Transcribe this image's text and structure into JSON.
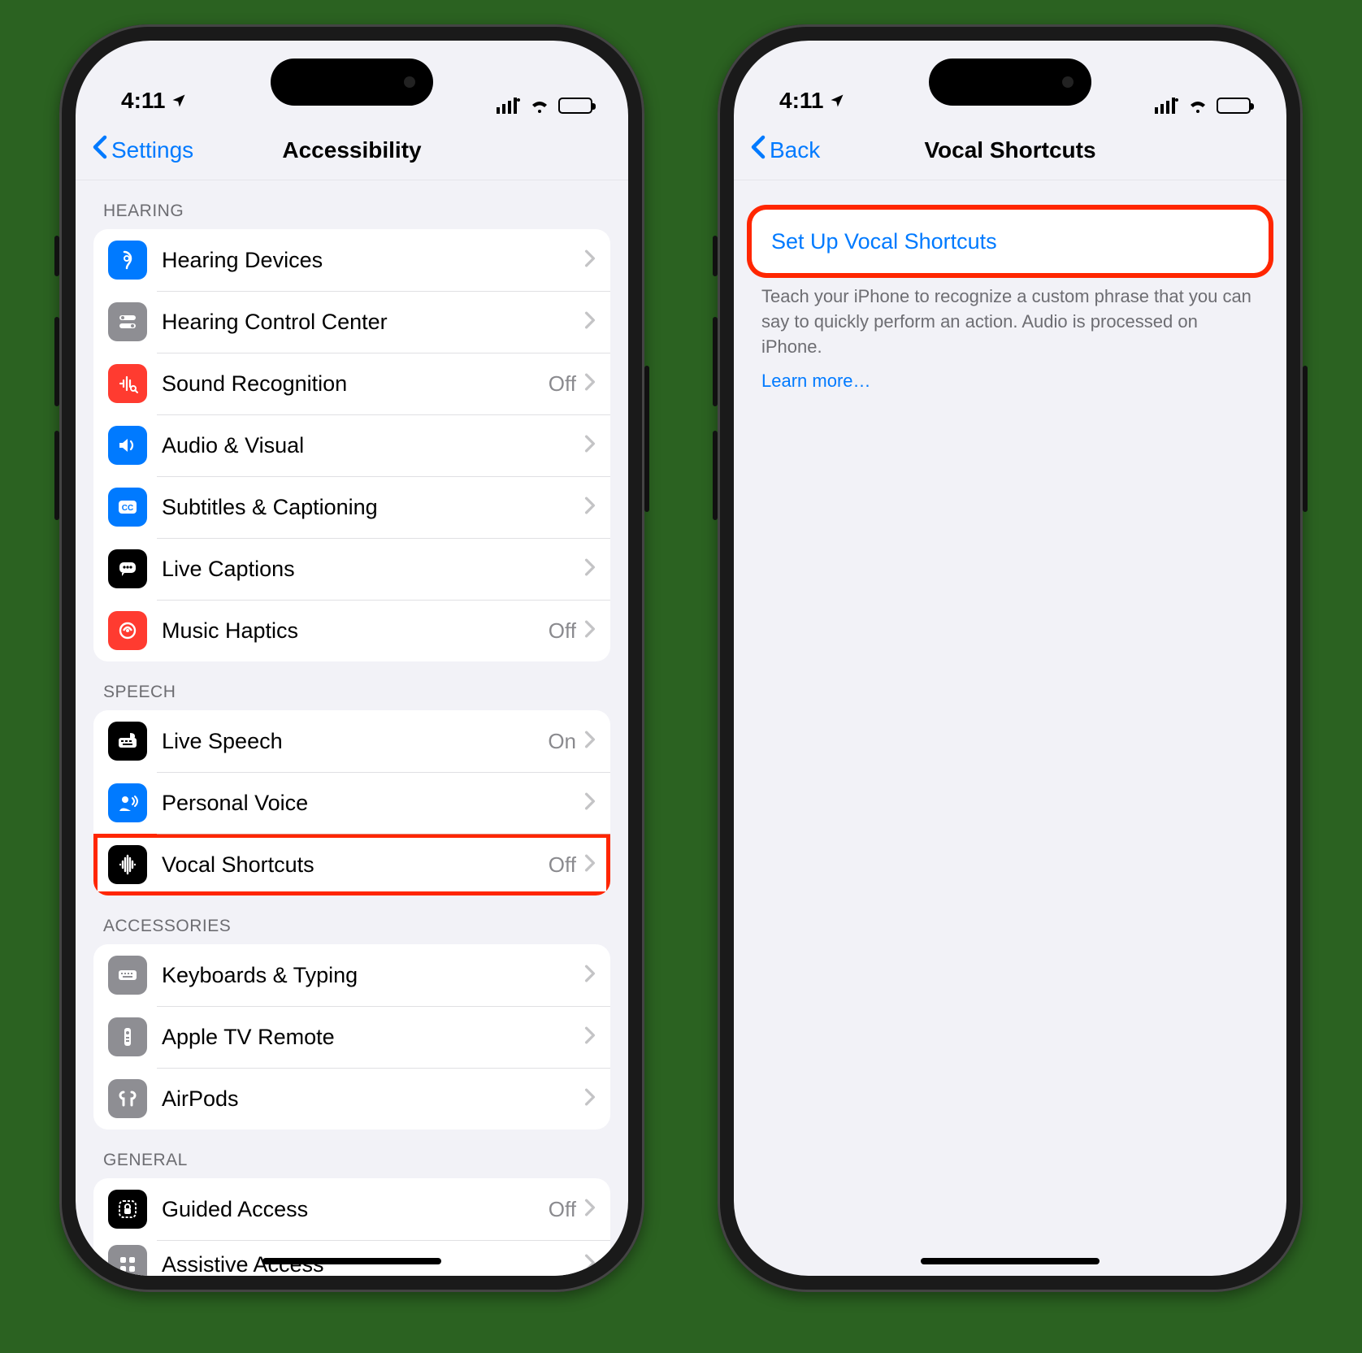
{
  "status": {
    "time": "4:11",
    "location_on": true
  },
  "phone1": {
    "nav": {
      "back": "Settings",
      "title": "Accessibility"
    },
    "sections": [
      {
        "header": "HEARING",
        "rows": [
          {
            "icon": "hearing-devices-icon",
            "bg": "ic-blue",
            "glyph": "ear",
            "label": "Hearing Devices",
            "detail": ""
          },
          {
            "icon": "hearing-control-center-icon",
            "bg": "ic-gray",
            "glyph": "switches",
            "label": "Hearing Control Center",
            "detail": ""
          },
          {
            "icon": "sound-recognition-icon",
            "bg": "ic-red",
            "glyph": "wave-search",
            "label": "Sound Recognition",
            "detail": "Off"
          },
          {
            "icon": "audio-visual-icon",
            "bg": "ic-blue",
            "glyph": "speaker",
            "label": "Audio & Visual",
            "detail": ""
          },
          {
            "icon": "subtitles-captioning-icon",
            "bg": "ic-blue",
            "glyph": "cc",
            "label": "Subtitles & Captioning",
            "detail": ""
          },
          {
            "icon": "live-captions-icon",
            "bg": "ic-black",
            "glyph": "bubble",
            "label": "Live Captions",
            "detail": ""
          },
          {
            "icon": "music-haptics-icon",
            "bg": "ic-red",
            "glyph": "haptics",
            "label": "Music Haptics",
            "detail": "Off"
          }
        ]
      },
      {
        "header": "SPEECH",
        "rows": [
          {
            "icon": "live-speech-icon",
            "bg": "ic-black",
            "glyph": "keyboard-bubble",
            "label": "Live Speech",
            "detail": "On"
          },
          {
            "icon": "personal-voice-icon",
            "bg": "ic-blue",
            "glyph": "person-wave",
            "label": "Personal Voice",
            "detail": ""
          },
          {
            "icon": "vocal-shortcuts-icon",
            "bg": "ic-black",
            "glyph": "waveform",
            "label": "Vocal Shortcuts",
            "detail": "Off",
            "highlight": true
          }
        ]
      },
      {
        "header": "ACCESSORIES",
        "rows": [
          {
            "icon": "keyboards-typing-icon",
            "bg": "ic-gray",
            "glyph": "keyboard",
            "label": "Keyboards & Typing",
            "detail": ""
          },
          {
            "icon": "apple-tv-remote-icon",
            "bg": "ic-gray",
            "glyph": "remote",
            "label": "Apple TV Remote",
            "detail": ""
          },
          {
            "icon": "airpods-icon",
            "bg": "ic-gray",
            "glyph": "airpods",
            "label": "AirPods",
            "detail": ""
          }
        ]
      },
      {
        "header": "GENERAL",
        "rows": [
          {
            "icon": "guided-access-icon",
            "bg": "ic-black",
            "glyph": "lock-square",
            "label": "Guided Access",
            "detail": "Off"
          },
          {
            "icon": "assistive-access-icon",
            "bg": "ic-gray",
            "glyph": "grid",
            "label": "Assistive Access",
            "detail": "",
            "partial": true
          }
        ]
      }
    ]
  },
  "phone2": {
    "nav": {
      "back": "Back",
      "title": "Vocal Shortcuts"
    },
    "setup_label": "Set Up Vocal Shortcuts",
    "footer": "Teach your iPhone to recognize a custom phrase that you can say to quickly perform an action. Audio is processed on iPhone.",
    "learn_more": "Learn more…"
  }
}
